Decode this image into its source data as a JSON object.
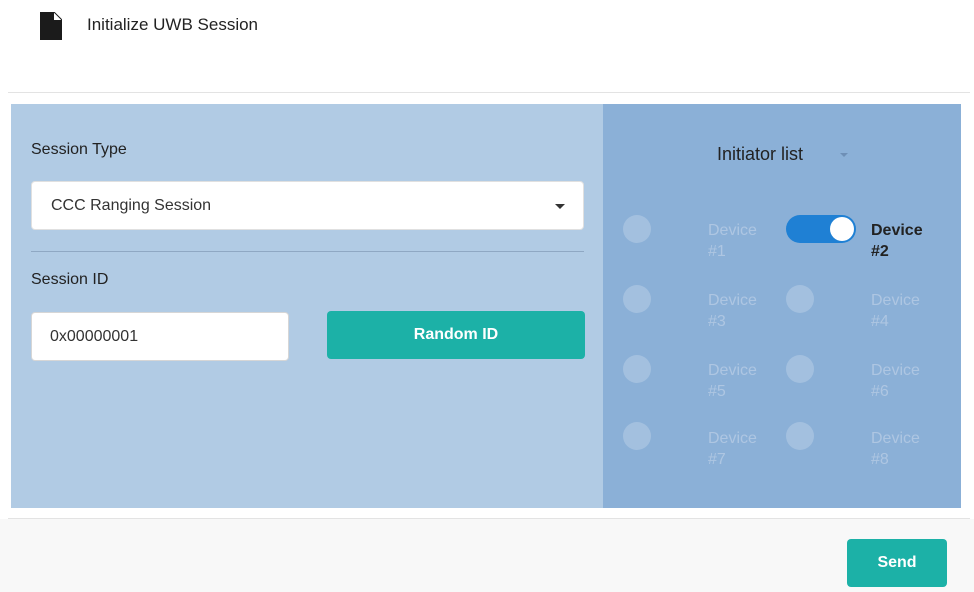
{
  "header": {
    "title": "Initialize UWB Session",
    "icon": "document-icon"
  },
  "session": {
    "type_label": "Session Type",
    "type_value": "CCC Ranging Session",
    "id_label": "Session ID",
    "id_value": "0x00000001",
    "random_label": "Random ID"
  },
  "initiator": {
    "title": "Initiator list",
    "devices": [
      {
        "label": "Device #1",
        "enabled": false
      },
      {
        "label": "Device #2",
        "enabled": true
      },
      {
        "label": "Device #3",
        "enabled": false
      },
      {
        "label": "Device #4",
        "enabled": false
      },
      {
        "label": "Device #5",
        "enabled": false
      },
      {
        "label": "Device #6",
        "enabled": false
      },
      {
        "label": "Device #7",
        "enabled": false
      },
      {
        "label": "Device #8",
        "enabled": false
      }
    ]
  },
  "footer": {
    "send_label": "Send"
  },
  "colors": {
    "accent": "#1cb1a7",
    "toggle_on": "#1f80d4",
    "left_panel": "#b1cbe4",
    "right_panel": "#8bb0d7"
  }
}
